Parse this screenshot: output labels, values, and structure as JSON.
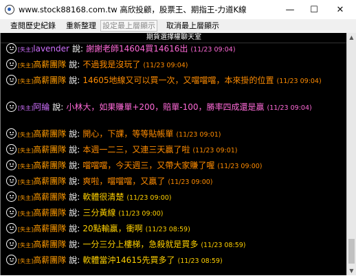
{
  "window": {
    "title": "www.stock88168.com.tw 高欣投顧，股票王、期指王-力道K線",
    "minimize": "—",
    "maximize": "☐",
    "close": "✕"
  },
  "toolbar": {
    "history": "查閱歷史紀錄",
    "refresh": "重新整理",
    "set_top": "設定最上層顯示",
    "cancel_top": "取消最上層顯示"
  },
  "room": {
    "title": "期貨選擇權聊天室"
  },
  "colors": {
    "agency": "#ff9a00",
    "user": "#d070ff",
    "pink_text": "#ff6ad8",
    "orange_text": "#ff8c00",
    "yellow_text": "#ffd000"
  },
  "messages": [
    {
      "tag": "[失主]",
      "name": "lavender",
      "says": "說:",
      "text": "謝謝老師14604買14616出",
      "time": "(11/23 09:04)"
    },
    {
      "tag": "[失主]",
      "name": "高薪團隊",
      "says": "說:",
      "text": "不過我是沒玩了",
      "time": "(11/23 09:04)"
    },
    {
      "tag": "[失主]",
      "name": "高薪團隊",
      "says": "說:",
      "text": "14605地線又可以買一次，又噹噹噹，本來掛的位置",
      "time": "(11/23 09:04)"
    },
    {
      "tag": "[失主]",
      "name": "阿綸",
      "says": "說:",
      "text": "小林大，如果賺單+200，賠單-100，勝率四成還是贏",
      "time": "(11/23 09:04)"
    },
    {
      "tag": "[失主]",
      "name": "高薪團隊",
      "says": "說:",
      "text": "開心，下課，等等貼帳單",
      "time": "(11/23 09:01)"
    },
    {
      "tag": "[失主]",
      "name": "高薪團隊",
      "says": "說:",
      "text": "本週一二三，又連三天贏了啦",
      "time": "(11/23 09:01)"
    },
    {
      "tag": "[失主]",
      "name": "高薪團隊",
      "says": "說:",
      "text": "噹噹噹，今天週三，又帶大家賺了喔",
      "time": "(11/23 09:00)"
    },
    {
      "tag": "[失主]",
      "name": "高薪團隊",
      "says": "說:",
      "text": "爽啦，噹噹噹，又贏了",
      "time": "(11/23 09:00)"
    },
    {
      "tag": "[失主]",
      "name": "高薪團隊",
      "says": "說:",
      "text": "軟體很清楚",
      "time": "(11/23 09:00)"
    },
    {
      "tag": "[失主]",
      "name": "高薪團隊",
      "says": "說:",
      "text": "三分黃線",
      "time": "(11/23 09:00)"
    },
    {
      "tag": "[失主]",
      "name": "高薪團隊",
      "says": "說:",
      "text": "20點輸贏，衝啊",
      "time": "(11/23 08:59)"
    },
    {
      "tag": "[失主]",
      "name": "高薪團隊",
      "says": "說:",
      "text": "一分三分上樓梯，急殺就是買多",
      "time": "(11/23 08:59)"
    },
    {
      "tag": "[失主]",
      "name": "高薪團隊",
      "says": "說:",
      "text": "軟體當沖14615先買多了",
      "time": "(11/23 08:59)"
    }
  ]
}
